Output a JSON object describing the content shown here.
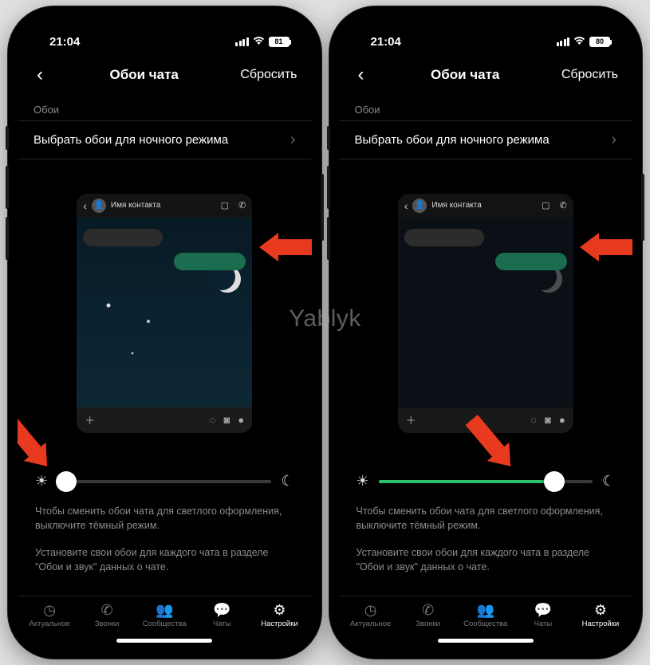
{
  "watermark": "Yablyk",
  "phones": [
    {
      "status": {
        "time": "21:04",
        "battery": "81"
      },
      "nav": {
        "title": "Обои чата",
        "reset": "Сбросить"
      },
      "section_label": "Обои",
      "row_label": "Выбрать обои для ночного режима",
      "contact": "Имя контакта",
      "slider_pct": 4,
      "hint1": "Чтобы сменить обои чата для светлого оформления, выключите тёмный режим.",
      "hint2": "Установите свои обои для каждого чата в разделе \"Обои и звук\" данных о чате."
    },
    {
      "status": {
        "time": "21:04",
        "battery": "80"
      },
      "nav": {
        "title": "Обои чата",
        "reset": "Сбросить"
      },
      "section_label": "Обои",
      "row_label": "Выбрать обои для ночного режима",
      "contact": "Имя контакта",
      "slider_pct": 82,
      "hint1": "Чтобы сменить обои чата для светлого оформления, выключите тёмный режим.",
      "hint2": "Установите свои обои для каждого чата в разделе \"Обои и звук\" данных о чате."
    }
  ],
  "tabs": [
    {
      "label": "Актуальное"
    },
    {
      "label": "Звонки"
    },
    {
      "label": "Сообщества"
    },
    {
      "label": "Чаты"
    },
    {
      "label": "Настройки"
    }
  ]
}
